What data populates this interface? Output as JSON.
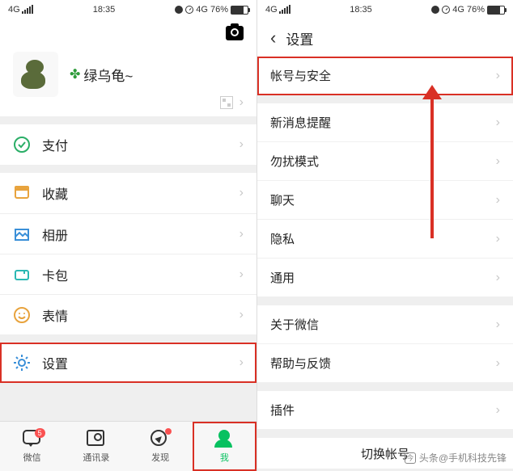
{
  "status": {
    "net": "4G",
    "time": "18:35",
    "battery": "76%",
    "net2": "4G"
  },
  "left": {
    "nickname": "绿乌龟~",
    "items": {
      "pay": "支付",
      "fav": "收藏",
      "album": "相册",
      "cards": "卡包",
      "emoji": "表情",
      "settings": "设置"
    },
    "tabs": {
      "chats": "微信",
      "contacts": "通讯录",
      "discover": "发现",
      "me": "我",
      "badge": "5"
    }
  },
  "right": {
    "title": "设置",
    "items": {
      "account": "帐号与安全",
      "notify": "新消息提醒",
      "dnd": "勿扰模式",
      "chat": "聊天",
      "privacy": "隐私",
      "general": "通用",
      "about": "关于微信",
      "help": "帮助与反馈",
      "plugins": "插件"
    },
    "switch": "切换帐号"
  },
  "watermark": "头条@手机科技先锋"
}
